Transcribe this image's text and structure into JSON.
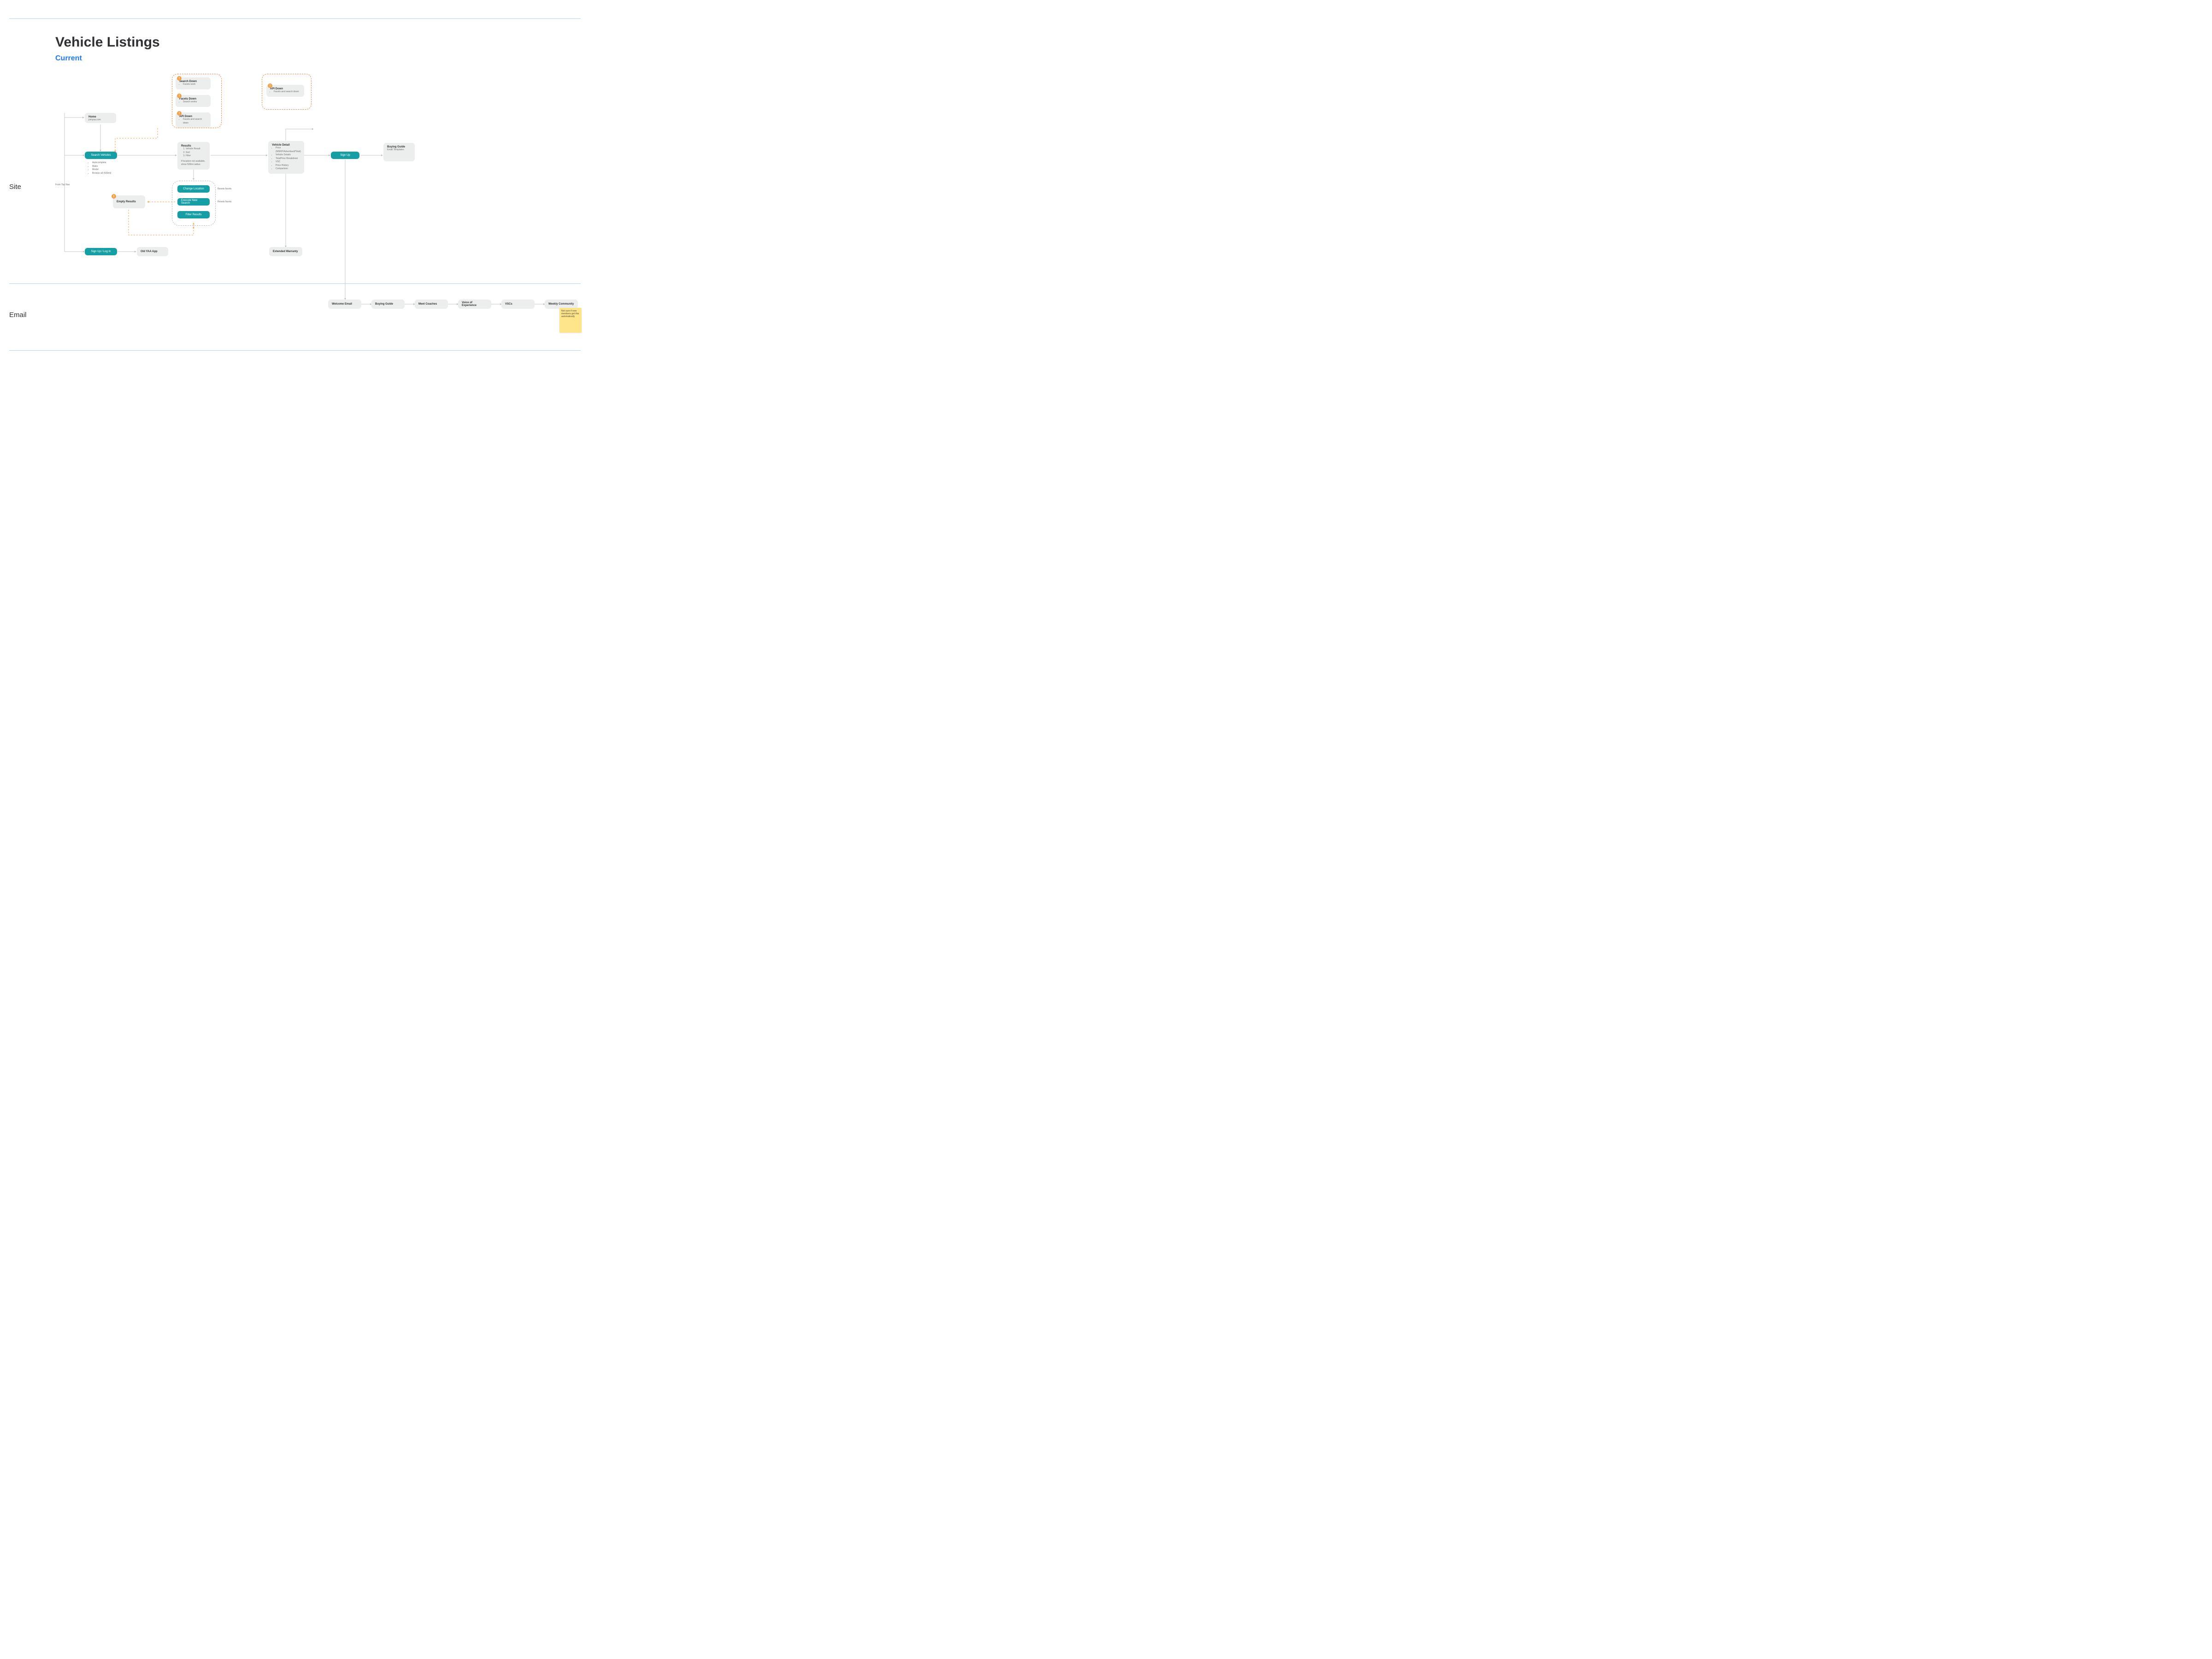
{
  "title": "Vehicle Listings",
  "subtitle": "Current",
  "sections": {
    "site": "Site",
    "email": "Email"
  },
  "nodes": {
    "home": {
      "title": "Home",
      "sub": "joinyaa.com"
    },
    "search_vehicles": "Search Vehicles",
    "search_vehicles_bullets": [
      "Autocomplete",
      "Make",
      "Model",
      "Browse all (500mi)"
    ],
    "signup_login": "Sign Up / Log In",
    "old_app": "Old YAA App",
    "results": {
      "title": "Results",
      "items": [
        "Vehicle Result",
        "Sort",
        "Filter"
      ],
      "note": "If location not available, show 500mi radius"
    },
    "change_location": "Change Location",
    "execute_new_search": "Execute New Search",
    "filter_results": "Filter Results",
    "resets_facets": "Resets facets",
    "empty_results": "Empty Results",
    "vehicle_detail": {
      "title": "Vehicle Detail",
      "items": [
        "Price (MSRP/Advertised/Total)",
        "Vehicle Details",
        "TotalPrice Breakdown",
        "VSC",
        "Price History",
        "Comparison"
      ]
    },
    "extended_warranty": "Extended Warranty",
    "signup": "Sign Up",
    "buying_guide": {
      "title": "Buying Guide",
      "sub": "Email Templates"
    },
    "errors": {
      "search_down": {
        "title": "Search Down",
        "sub": "Facets work"
      },
      "facets_down": {
        "title": "Facets Down",
        "sub": "Search works"
      },
      "api_down": {
        "title": "API Down",
        "sub": "Facets and search down"
      },
      "api_down2": {
        "title": "API Down",
        "sub": "Facets and search down"
      }
    },
    "from_top_nav": "From Top Nav"
  },
  "emails": {
    "welcome": "Welcome Email",
    "buying": "Buying Guide",
    "coaches": "Meet Coaches",
    "voice": "Voice of Experience",
    "vscs": "VSCs",
    "weekly": "Weekly Community"
  },
  "sticky": {
    "text": "Not sure if new members get this automatically"
  }
}
